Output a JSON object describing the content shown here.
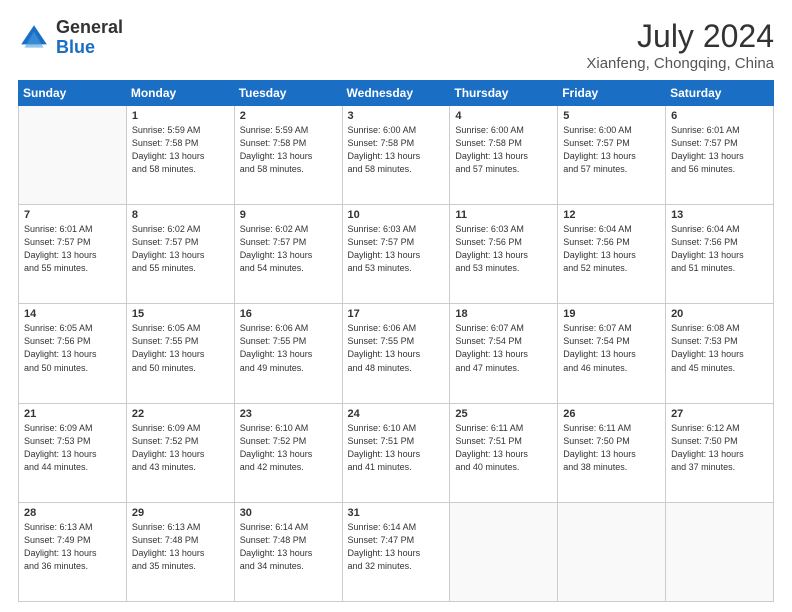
{
  "header": {
    "logo_general": "General",
    "logo_blue": "Blue",
    "month_year": "July 2024",
    "location": "Xianfeng, Chongqing, China"
  },
  "weekdays": [
    "Sunday",
    "Monday",
    "Tuesday",
    "Wednesday",
    "Thursday",
    "Friday",
    "Saturday"
  ],
  "weeks": [
    [
      {
        "day": "",
        "info": ""
      },
      {
        "day": "1",
        "info": "Sunrise: 5:59 AM\nSunset: 7:58 PM\nDaylight: 13 hours\nand 58 minutes."
      },
      {
        "day": "2",
        "info": "Sunrise: 5:59 AM\nSunset: 7:58 PM\nDaylight: 13 hours\nand 58 minutes."
      },
      {
        "day": "3",
        "info": "Sunrise: 6:00 AM\nSunset: 7:58 PM\nDaylight: 13 hours\nand 58 minutes."
      },
      {
        "day": "4",
        "info": "Sunrise: 6:00 AM\nSunset: 7:58 PM\nDaylight: 13 hours\nand 57 minutes."
      },
      {
        "day": "5",
        "info": "Sunrise: 6:00 AM\nSunset: 7:57 PM\nDaylight: 13 hours\nand 57 minutes."
      },
      {
        "day": "6",
        "info": "Sunrise: 6:01 AM\nSunset: 7:57 PM\nDaylight: 13 hours\nand 56 minutes."
      }
    ],
    [
      {
        "day": "7",
        "info": "Sunrise: 6:01 AM\nSunset: 7:57 PM\nDaylight: 13 hours\nand 55 minutes."
      },
      {
        "day": "8",
        "info": "Sunrise: 6:02 AM\nSunset: 7:57 PM\nDaylight: 13 hours\nand 55 minutes."
      },
      {
        "day": "9",
        "info": "Sunrise: 6:02 AM\nSunset: 7:57 PM\nDaylight: 13 hours\nand 54 minutes."
      },
      {
        "day": "10",
        "info": "Sunrise: 6:03 AM\nSunset: 7:57 PM\nDaylight: 13 hours\nand 53 minutes."
      },
      {
        "day": "11",
        "info": "Sunrise: 6:03 AM\nSunset: 7:56 PM\nDaylight: 13 hours\nand 53 minutes."
      },
      {
        "day": "12",
        "info": "Sunrise: 6:04 AM\nSunset: 7:56 PM\nDaylight: 13 hours\nand 52 minutes."
      },
      {
        "day": "13",
        "info": "Sunrise: 6:04 AM\nSunset: 7:56 PM\nDaylight: 13 hours\nand 51 minutes."
      }
    ],
    [
      {
        "day": "14",
        "info": "Sunrise: 6:05 AM\nSunset: 7:56 PM\nDaylight: 13 hours\nand 50 minutes."
      },
      {
        "day": "15",
        "info": "Sunrise: 6:05 AM\nSunset: 7:55 PM\nDaylight: 13 hours\nand 50 minutes."
      },
      {
        "day": "16",
        "info": "Sunrise: 6:06 AM\nSunset: 7:55 PM\nDaylight: 13 hours\nand 49 minutes."
      },
      {
        "day": "17",
        "info": "Sunrise: 6:06 AM\nSunset: 7:55 PM\nDaylight: 13 hours\nand 48 minutes."
      },
      {
        "day": "18",
        "info": "Sunrise: 6:07 AM\nSunset: 7:54 PM\nDaylight: 13 hours\nand 47 minutes."
      },
      {
        "day": "19",
        "info": "Sunrise: 6:07 AM\nSunset: 7:54 PM\nDaylight: 13 hours\nand 46 minutes."
      },
      {
        "day": "20",
        "info": "Sunrise: 6:08 AM\nSunset: 7:53 PM\nDaylight: 13 hours\nand 45 minutes."
      }
    ],
    [
      {
        "day": "21",
        "info": "Sunrise: 6:09 AM\nSunset: 7:53 PM\nDaylight: 13 hours\nand 44 minutes."
      },
      {
        "day": "22",
        "info": "Sunrise: 6:09 AM\nSunset: 7:52 PM\nDaylight: 13 hours\nand 43 minutes."
      },
      {
        "day": "23",
        "info": "Sunrise: 6:10 AM\nSunset: 7:52 PM\nDaylight: 13 hours\nand 42 minutes."
      },
      {
        "day": "24",
        "info": "Sunrise: 6:10 AM\nSunset: 7:51 PM\nDaylight: 13 hours\nand 41 minutes."
      },
      {
        "day": "25",
        "info": "Sunrise: 6:11 AM\nSunset: 7:51 PM\nDaylight: 13 hours\nand 40 minutes."
      },
      {
        "day": "26",
        "info": "Sunrise: 6:11 AM\nSunset: 7:50 PM\nDaylight: 13 hours\nand 38 minutes."
      },
      {
        "day": "27",
        "info": "Sunrise: 6:12 AM\nSunset: 7:50 PM\nDaylight: 13 hours\nand 37 minutes."
      }
    ],
    [
      {
        "day": "28",
        "info": "Sunrise: 6:13 AM\nSunset: 7:49 PM\nDaylight: 13 hours\nand 36 minutes."
      },
      {
        "day": "29",
        "info": "Sunrise: 6:13 AM\nSunset: 7:48 PM\nDaylight: 13 hours\nand 35 minutes."
      },
      {
        "day": "30",
        "info": "Sunrise: 6:14 AM\nSunset: 7:48 PM\nDaylight: 13 hours\nand 34 minutes."
      },
      {
        "day": "31",
        "info": "Sunrise: 6:14 AM\nSunset: 7:47 PM\nDaylight: 13 hours\nand 32 minutes."
      },
      {
        "day": "",
        "info": ""
      },
      {
        "day": "",
        "info": ""
      },
      {
        "day": "",
        "info": ""
      }
    ]
  ]
}
